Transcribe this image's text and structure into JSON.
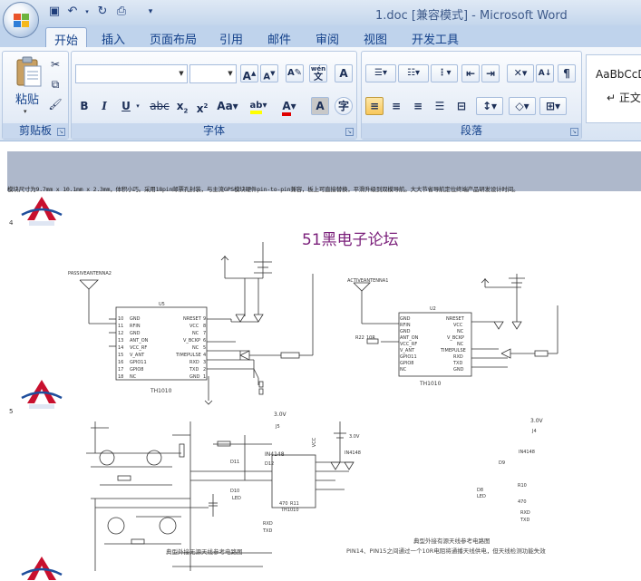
{
  "window": {
    "title": "1.doc [兼容模式] - Microsoft Word"
  },
  "quick_access": {
    "icons": [
      "save-icon",
      "undo-icon",
      "redo-icon",
      "print-preview-icon",
      "customize-icon"
    ]
  },
  "tabs": [
    {
      "label": "开始",
      "active": true
    },
    {
      "label": "插入"
    },
    {
      "label": "页面布局"
    },
    {
      "label": "引用"
    },
    {
      "label": "邮件"
    },
    {
      "label": "审阅"
    },
    {
      "label": "视图"
    },
    {
      "label": "开发工具"
    }
  ],
  "ribbon": {
    "clipboard": {
      "label": "剪贴板",
      "paste_label": "粘贴"
    },
    "font": {
      "label": "字体",
      "font_name": "",
      "font_size": "",
      "phonetic": "wén",
      "phonetic_char": "文"
    },
    "paragraph": {
      "label": "段落"
    },
    "styles": {
      "sample": "AaBbCcD",
      "name": "↵ 正文"
    }
  },
  "document": {
    "highlight_text": "模块尺寸为9.7mm x 10.1mm x 2.3mm，体积小巧。采用18pin邮票孔封装，与主流GPS模块硬件pin-to-pin兼容，板上可直接替换，平滑升级到双模导航。大大节省导航定位终端产品研发设计时间。",
    "line_4": "4",
    "line_5": "5",
    "forum_title": "51黑电子论坛",
    "schematic1": {
      "antenna": "PASSIVEANTENNA2",
      "chip_name": "U5",
      "chip_label": "TH1010",
      "pins_left": [
        "GND",
        "RFIN",
        "GND",
        "ANT_ON",
        "VCC_RF",
        "V_ANT",
        "GPIO11",
        "GPIO8",
        "NC"
      ],
      "pins_left_nums": [
        "10",
        "11",
        "12",
        "13",
        "14",
        "15",
        "16",
        "17",
        "18"
      ],
      "pins_right": [
        "NRESET",
        "VCC",
        "NC",
        "V_BCKP",
        "NC",
        "TIMEPULSE",
        "RXD",
        "TXD",
        "GND"
      ],
      "pins_right_nums": [
        "9",
        "8",
        "7",
        "6",
        "5",
        "4",
        "3",
        "2",
        "1"
      ],
      "battery": "3.0V",
      "battery_ref": "J5",
      "diode": "IN4148",
      "d11": "D11",
      "d12": "D12",
      "d10": "D10",
      "led": "LED",
      "resistor": "470",
      "r11": "R11",
      "rxd": "RXD",
      "txd": "TXD",
      "vcc": "VCC",
      "caption": "典型外接无源天线参考电路图"
    },
    "schematic2": {
      "antenna": "ACTIVEANTENNA1",
      "chip_name": "U2",
      "chip_label": "TH1010",
      "pins_left": [
        "GND",
        "RFIN",
        "GND",
        "ANT_ON",
        "VCC_RF",
        "V_ANT",
        "GPIO11",
        "GPIO8",
        "NC"
      ],
      "pins_right": [
        "NRESET",
        "VCC",
        "NC",
        "V_BCKP",
        "NC",
        "TIMEPULSE",
        "RXD",
        "TXD",
        "GND"
      ],
      "r22": "R22",
      "r22_val": "10R",
      "battery": "3.0V",
      "battery_ref": "J4",
      "diode": "IN4148",
      "d9": "D9",
      "d8": "D8",
      "led": "LED",
      "resistor": "470",
      "r10": "R10",
      "rxd": "RXD",
      "txd": "TXD",
      "caption": "典型外接有源天线参考电路图",
      "note": "PIN14、PIN15之间通过一个10R电阻将通播天线供电，但天线检测功能失效"
    },
    "schematic3": {
      "chip_label": "TH1010",
      "battery": "3.0V",
      "diode": "IN4148"
    }
  },
  "colors": {
    "ribbon_bg": "#dfe8f5",
    "highlight": "#aeb8cb",
    "forum_title": "#7a1f7a",
    "logo_red": "#c8102e",
    "logo_blue": "#1f4e9c"
  }
}
